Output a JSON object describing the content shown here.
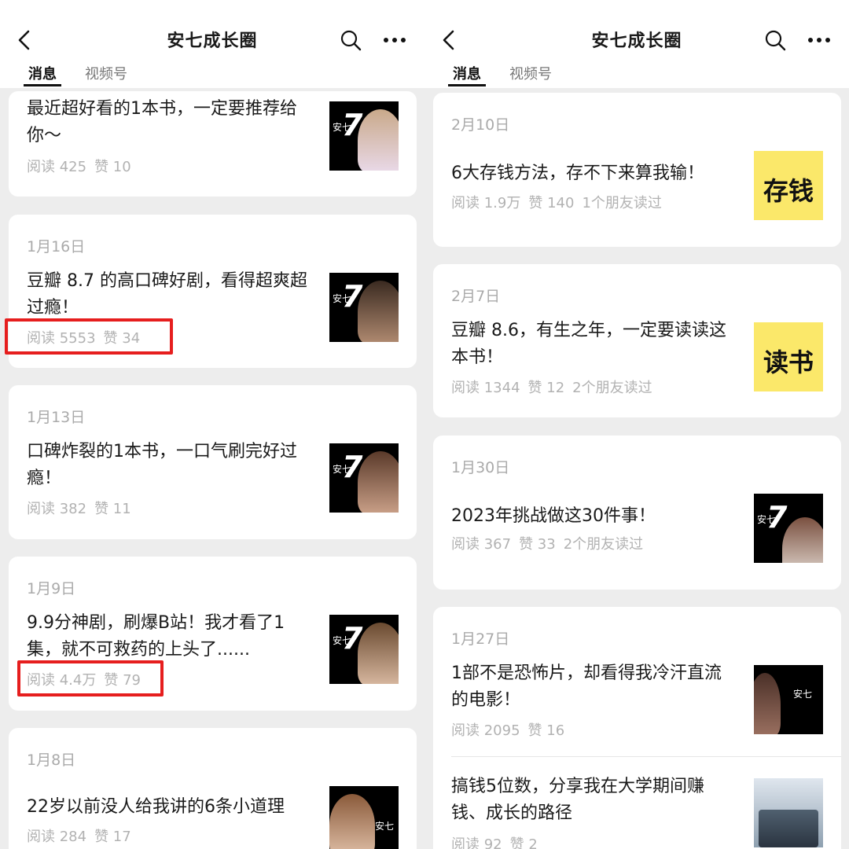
{
  "header": {
    "title": "安七成长圈",
    "tabs": [
      "消息",
      "视频号"
    ]
  },
  "left_panel": {
    "cards": [
      {
        "date": "",
        "headline": "最近超好看的1本书，一定要推荐给你～",
        "reads": "阅读 425",
        "likes": "赞 10",
        "friends": ""
      },
      {
        "date": "1月16日",
        "headline": "豆瓣 8.7 的高口碑好剧，看得超爽超过瘾！",
        "reads": "阅读 5553",
        "likes": "赞 34",
        "friends": ""
      },
      {
        "date": "1月13日",
        "headline": "口碑炸裂的1本书，一口气刷完好过瘾！",
        "reads": "阅读 382",
        "likes": "赞 11",
        "friends": ""
      },
      {
        "date": "1月9日",
        "headline": "9.9分神剧，刷爆B站！我才看了1集，就不可救药的上头了......",
        "reads": "阅读 4.4万",
        "likes": "赞 79",
        "friends": ""
      },
      {
        "date": "1月8日",
        "headline": "22岁以前没人给我讲的6条小道理",
        "reads": "阅读 284",
        "likes": "赞 17",
        "friends": ""
      }
    ]
  },
  "right_panel": {
    "cards": [
      {
        "date": "2月10日",
        "headline": "6大存钱方法，存不下来算我输！",
        "reads": "阅读 1.9万",
        "likes": "赞 140",
        "friends": "1个朋友读过",
        "thumb_word": "存钱"
      },
      {
        "date": "2月7日",
        "headline": "豆瓣 8.6，有生之年，一定要读读这本书！",
        "reads": "阅读 1344",
        "likes": "赞 12",
        "friends": "2个朋友读过",
        "thumb_word": "读书"
      },
      {
        "date": "1月30日",
        "headline": "2023年挑战做这30件事！",
        "reads": "阅读 367",
        "likes": "赞 33",
        "friends": "2个朋友读过",
        "thumb_word": ""
      },
      {
        "date": "1月27日",
        "headline": "1部不是恐怖片，却看得我冷汗直流的电影！",
        "reads": "阅读 2095",
        "likes": "赞 16",
        "friends": "",
        "thumb_word": ""
      },
      {
        "date": "",
        "headline": "搞钱5位数，分享我在大学期间赚钱、成长的路径",
        "reads": "阅读 92",
        "likes": "赞 2",
        "friends": "",
        "thumb_word": ""
      }
    ]
  },
  "thumb_brand": {
    "brand": "安七",
    "numeral": "7"
  },
  "colors": {
    "highlight": "#e61e1e",
    "yellow_thumb": "#fbe86a",
    "background": "#ededed"
  },
  "icons": [
    "back-arrow-icon",
    "search-icon",
    "more-dots-icon"
  ]
}
